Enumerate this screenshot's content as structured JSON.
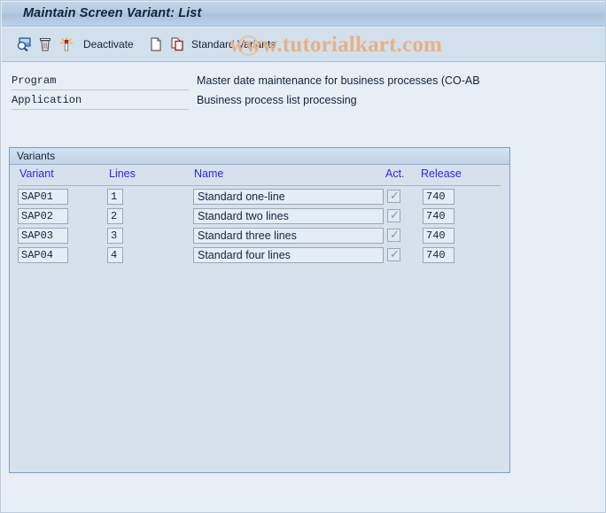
{
  "window": {
    "title": "Maintain Screen Variant: List"
  },
  "watermark": {
    "text": "www.tutorialkart.com"
  },
  "toolbar": {
    "items": [
      {
        "name": "display-icon",
        "icon": "magnifier-display-icon",
        "label": ""
      },
      {
        "name": "delete-icon",
        "icon": "trash-icon",
        "label": ""
      },
      {
        "name": "activate-icon",
        "icon": "spark-activate-icon",
        "label": ""
      },
      {
        "name": "deactivate",
        "icon": "",
        "label": "Deactivate"
      },
      {
        "name": "create-icon",
        "icon": "blank-page-icon",
        "label": ""
      },
      {
        "name": "copy-icon",
        "icon": "copy-page-icon",
        "label": ""
      },
      {
        "name": "standard-variants",
        "icon": "",
        "label": "Standard Variants"
      }
    ]
  },
  "info": {
    "rows": [
      {
        "label": "Program",
        "value": "Master date maintenance for business processes (CO-AB"
      },
      {
        "label": "Application",
        "value": "Business process list processing"
      }
    ]
  },
  "variants_panel": {
    "title": "Variants",
    "columns": [
      {
        "key": "variant",
        "label": "Variant"
      },
      {
        "key": "lines",
        "label": "Lines"
      },
      {
        "key": "name",
        "label": "Name"
      },
      {
        "key": "act",
        "label": "Act."
      },
      {
        "key": "release",
        "label": "Release"
      }
    ],
    "rows": [
      {
        "variant": "SAP01",
        "lines": "1",
        "name": "Standard one-line",
        "act": true,
        "release": "740"
      },
      {
        "variant": "SAP02",
        "lines": "2",
        "name": "Standard two lines",
        "act": true,
        "release": "740"
      },
      {
        "variant": "SAP03",
        "lines": "3",
        "name": "Standard three lines",
        "act": true,
        "release": "740"
      },
      {
        "variant": "SAP04",
        "lines": "4",
        "name": "Standard four lines",
        "act": true,
        "release": "740"
      }
    ]
  },
  "colors": {
    "titlebar": "#b3c9e2",
    "toolbar": "#d2dfec",
    "page_background": "#e8eef6",
    "panel_background": "#d6e1ec",
    "panel_border": "#7b9ec4",
    "header_text": "#2a2ae0",
    "watermark": "#e8b184"
  }
}
